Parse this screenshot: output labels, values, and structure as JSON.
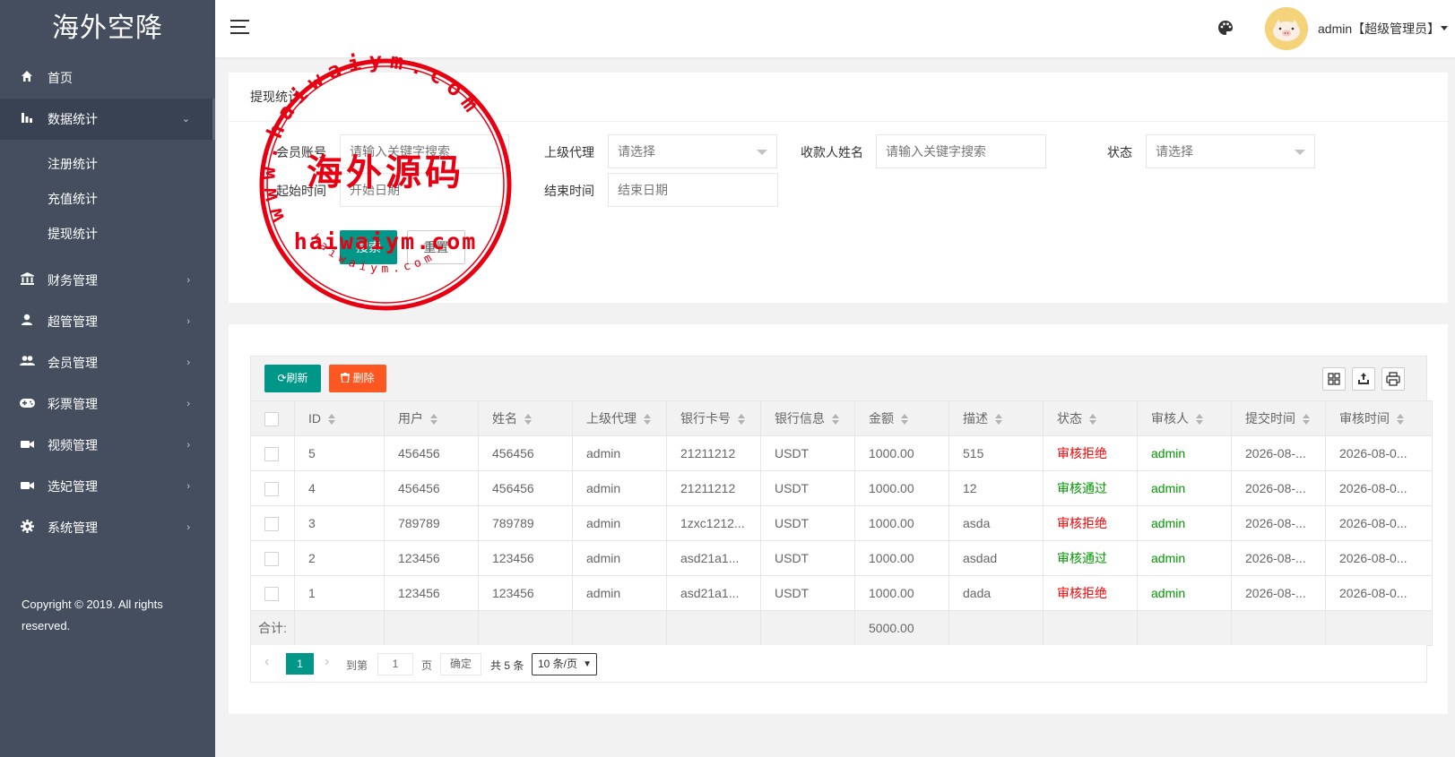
{
  "sidebar": {
    "logo": "海外空降",
    "menu": [
      {
        "label": "首页",
        "icon": "home-icon",
        "has_arrow": false
      },
      {
        "label": "数据统计",
        "icon": "bar-chart-icon",
        "has_arrow": true
      },
      {
        "label": "财务管理",
        "icon": "bank-icon",
        "has_arrow": true
      },
      {
        "label": "超管管理",
        "icon": "user-icon",
        "has_arrow": true
      },
      {
        "label": "会员管理",
        "icon": "users-icon",
        "has_arrow": true
      },
      {
        "label": "彩票管理",
        "icon": "gamepad-icon",
        "has_arrow": true
      },
      {
        "label": "视频管理",
        "icon": "video-camera-icon",
        "has_arrow": true
      },
      {
        "label": "选妃管理",
        "icon": "video-camera-icon",
        "has_arrow": true
      },
      {
        "label": "系统管理",
        "icon": "gear-icon",
        "has_arrow": true
      }
    ],
    "submenu": [
      "注册统计",
      "充值统计",
      "提现统计"
    ],
    "copyright": "Copyright © 2019. All rights reserved."
  },
  "header": {
    "user": "admin【超级管理员】"
  },
  "watermark": {
    "outer_text": "www.haiwaiym.com",
    "center_text": "海外源码",
    "band_text": "haiwaiym.com",
    "bottom_text": "haiwaiym.com"
  },
  "filter": {
    "title": "提现统计",
    "member_label": "会员账号",
    "member_placeholder": "请输入关键字搜索",
    "agent_label": "上级代理",
    "agent_value": "请选择",
    "payee_label": "收款人姓名",
    "payee_placeholder": "请输入关键字搜索",
    "status_label": "状态",
    "status_value": "请选择",
    "start_label": "起始时间",
    "start_placeholder": "开始日期",
    "end_label": "结束时间",
    "end_placeholder": "结束日期",
    "search_button": "搜索",
    "reset_button": "重置"
  },
  "table": {
    "refresh_button": "刷新",
    "delete_button": "删除",
    "columns": [
      "ID",
      "用户",
      "姓名",
      "上级代理",
      "银行卡号",
      "银行信息",
      "金额",
      "描述",
      "状态",
      "审核人",
      "提交时间",
      "审核时间"
    ],
    "rows": [
      {
        "id": "5",
        "user": "456456",
        "name": "456456",
        "agent": "admin",
        "card": "21211212",
        "bank": "USDT",
        "amount": "1000.00",
        "desc": "515",
        "status": "审核拒绝",
        "status_color": "#ff0000",
        "auditor": "admin",
        "submit_time": "2026-08-...",
        "audit_time": "2026-08-0..."
      },
      {
        "id": "4",
        "user": "456456",
        "name": "456456",
        "agent": "admin",
        "card": "21211212",
        "bank": "USDT",
        "amount": "1000.00",
        "desc": "12",
        "status": "审核通过",
        "status_color": "#009900",
        "auditor": "admin",
        "submit_time": "2026-08-...",
        "audit_time": "2026-08-0..."
      },
      {
        "id": "3",
        "user": "789789",
        "name": "789789",
        "agent": "admin",
        "card": "1zxc1212...",
        "bank": "USDT",
        "amount": "1000.00",
        "desc": "asda",
        "status": "审核拒绝",
        "status_color": "#ff0000",
        "auditor": "admin",
        "submit_time": "2026-08-...",
        "audit_time": "2026-08-0..."
      },
      {
        "id": "2",
        "user": "123456",
        "name": "123456",
        "agent": "admin",
        "card": "asd21a1...",
        "bank": "USDT",
        "amount": "1000.00",
        "desc": "asdad",
        "status": "审核通过",
        "status_color": "#009900",
        "auditor": "admin",
        "submit_time": "2026-08-...",
        "audit_time": "2026-08-0..."
      },
      {
        "id": "1",
        "user": "123456",
        "name": "123456",
        "agent": "admin",
        "card": "asd21a1...",
        "bank": "USDT",
        "amount": "1000.00",
        "desc": "dada",
        "status": "审核拒绝",
        "status_color": "#ff0000",
        "auditor": "admin",
        "submit_time": "2026-08-...",
        "audit_time": "2026-08-0..."
      }
    ],
    "total_label": "合计:",
    "total_amount": "5000.00"
  },
  "pager": {
    "current_page": "1",
    "goto_label": "到第",
    "goto_value": "1",
    "page_unit": "页",
    "confirm": "确定",
    "total": "共 5 条",
    "page_size": "10 条/页"
  }
}
